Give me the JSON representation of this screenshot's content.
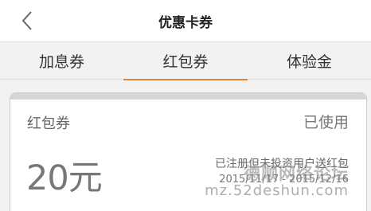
{
  "header": {
    "title": "优惠卡券",
    "back_icon": "chevron-left-icon"
  },
  "tabs": [
    {
      "label": "加息券",
      "active": false
    },
    {
      "label": "红包券",
      "active": true
    },
    {
      "label": "体验金",
      "active": false
    }
  ],
  "card": {
    "type": "红包券",
    "status": "已使用",
    "amount": "20元",
    "description": "已注册但未投资用户送红包",
    "validity": "2015/11/17 - 2015/12/16"
  },
  "watermark": {
    "line1": "德顺网络论坛",
    "line2": "mz.52deshun.com"
  },
  "colors": {
    "accent": "#e0843c",
    "background": "#f2f2f2"
  }
}
